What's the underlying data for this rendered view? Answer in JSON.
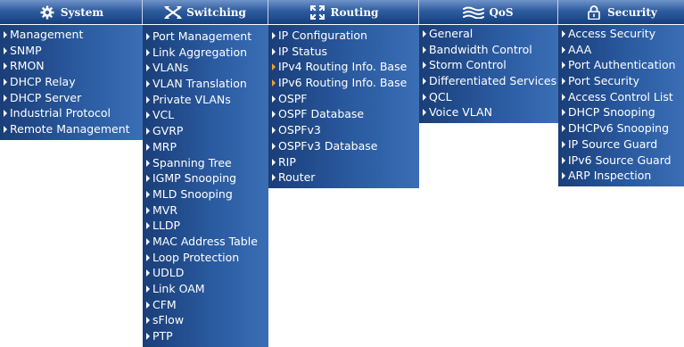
{
  "tabs": {
    "system": {
      "label": "System",
      "icon": "gear-icon"
    },
    "switching": {
      "label": "Switching",
      "icon": "switching-arrows-icon"
    },
    "routing": {
      "label": "Routing",
      "icon": "routing-arrows-icon"
    },
    "qos": {
      "label": "QoS",
      "icon": "qos-wave-icon"
    },
    "security": {
      "label": "Security",
      "icon": "padlock-icon"
    }
  },
  "menus": {
    "system": [
      "Management",
      "SNMP",
      "RMON",
      "DHCP Relay",
      "DHCP Server",
      "Industrial Protocol",
      "Remote Management"
    ],
    "switching": [
      "Port Management",
      "Link Aggregation",
      "VLANs",
      "VLAN Translation",
      "Private VLANs",
      "VCL",
      "GVRP",
      "MRP",
      "Spanning Tree",
      "IGMP Snooping",
      "MLD Snooping",
      "MVR",
      "LLDP",
      "MAC Address Table",
      "Loop Protection",
      "UDLD",
      "Link OAM",
      "CFM",
      "sFlow",
      "PTP"
    ],
    "routing": [
      "IP Configuration",
      "IP Status",
      "IPv4 Routing Info. Base",
      "IPv6 Routing Info. Base",
      "OSPF",
      "OSPF Database",
      "OSPFv3",
      "OSPFv3 Database",
      "RIP",
      "Router"
    ],
    "qos": [
      "General",
      "Bandwidth Control",
      "Storm Control",
      "Differentiated Services",
      "QCL",
      "Voice VLAN"
    ],
    "security": [
      "Access Security",
      "AAA",
      "Port Authentication",
      "Port Security",
      "Access Control List",
      "DHCP Snooping",
      "DHCPv6 Snooping",
      "IP Source Guard",
      "IPv6 Source Guard",
      "ARP Inspection"
    ]
  },
  "colors": {
    "menu_dark": "#1a3e78",
    "menu_light": "#3a6eb5",
    "accent_arrow": "#f0a030"
  }
}
